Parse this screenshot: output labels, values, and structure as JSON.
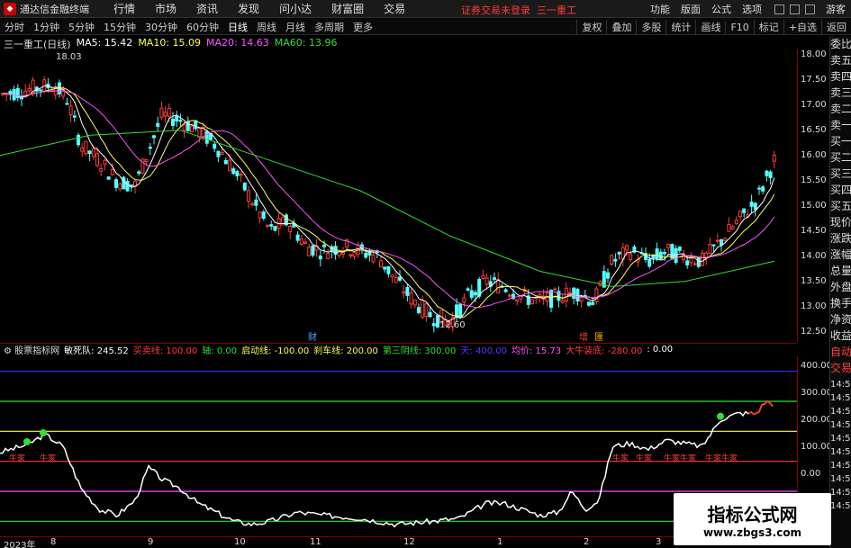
{
  "app": {
    "title": "通达信金融终端",
    "logo_icon": "tdx-logo-icon"
  },
  "menu": [
    "行情",
    "市场",
    "资讯",
    "发现",
    "问小达",
    "财富圈",
    "交易"
  ],
  "login_warning": "证券交易未登录",
  "stock_short": "三一重工",
  "right_menu": [
    "功能",
    "版面",
    "公式",
    "选项"
  ],
  "guest": "游客",
  "periods": [
    "分时",
    "1分钟",
    "5分钟",
    "15分钟",
    "30分钟",
    "60分钟",
    "日线",
    "周线",
    "月线",
    "多周期",
    "更多"
  ],
  "active_period": "日线",
  "toolbar_right": [
    "复权",
    "叠加",
    "多股",
    "统计",
    "画线",
    "F10",
    "标记",
    "+自选",
    "返回"
  ],
  "ma_legend": {
    "stock": "三一重工(日线)",
    "ma5": "MA5: 15.42",
    "ma10": "MA10: 15.09",
    "ma20": "MA20: 14.63",
    "ma60": "MA60: 13.96"
  },
  "colors": {
    "up": "#ff3b3b",
    "down": "#54ffff",
    "ma5": "#ffffff",
    "ma10": "#ffff55",
    "ma20": "#ff55ff",
    "ma60": "#33dd33",
    "axis": "#8a0000"
  },
  "price_axis": [
    "18.00",
    "17.50",
    "17.00",
    "16.50",
    "16.00",
    "15.50",
    "15.00",
    "14.50",
    "14.00",
    "13.50",
    "13.00",
    "12.50"
  ],
  "annotations": {
    "high": "18.03",
    "low": "12.60",
    "cai": "财",
    "zeng": "增",
    "box": "匯"
  },
  "vtabs": [
    "委比",
    "卖五",
    "卖四",
    "卖三",
    "卖二",
    "卖一",
    "买一",
    "买二",
    "买三",
    "买四",
    "买五",
    "现价",
    "涨跌",
    "涨幅",
    "总量",
    "外盘",
    "换手",
    "净资",
    "收益",
    "自动",
    "交易"
  ],
  "times": [
    "14:50",
    "14:50",
    "14:50",
    "14:50",
    "14:50",
    "14:50",
    "14:50",
    "14:50",
    "14:50",
    "14:50"
  ],
  "indicator": {
    "name": "股票指标网",
    "items": [
      {
        "label": "敏死队:",
        "value": "245.52",
        "color": "#ffffff"
      },
      {
        "label": "买卖线:",
        "value": "100.00",
        "color": "#ff3b3b"
      },
      {
        "label": "轴:",
        "value": "0.00",
        "color": "#33dd33"
      },
      {
        "label": "启动线:",
        "value": "-100.00",
        "color": "#ffff55"
      },
      {
        "label": "刹车线:",
        "value": "200.00",
        "color": "#ffff55"
      },
      {
        "label": "第三阴线:",
        "value": "300.00",
        "color": "#33dd33"
      },
      {
        "label": "天:",
        "value": "400.00",
        "color": "#4040ff"
      },
      {
        "label": "均价:",
        "value": "15.73",
        "color": "#ff55ff"
      },
      {
        "label": "大牛装底:",
        "value": "-280.00",
        "color": "#ff3b3b"
      },
      {
        "label": ":",
        "value": "0.00",
        "color": "#ffffff"
      }
    ],
    "axis": [
      "400.00",
      "300.00",
      "200.00",
      "100.00",
      "0.00",
      "-100.00"
    ],
    "signal_labels": [
      "牛家",
      "牛家",
      "牛家",
      "牛家",
      "牛家牛家",
      "牛家牛家"
    ]
  },
  "dates": [
    "2023年",
    "8",
    "9",
    "10",
    "11",
    "12",
    "1",
    "2",
    "3",
    "4"
  ],
  "watermark": {
    "line1": "指标公式网",
    "line2": "www.zbgs3.com"
  }
}
